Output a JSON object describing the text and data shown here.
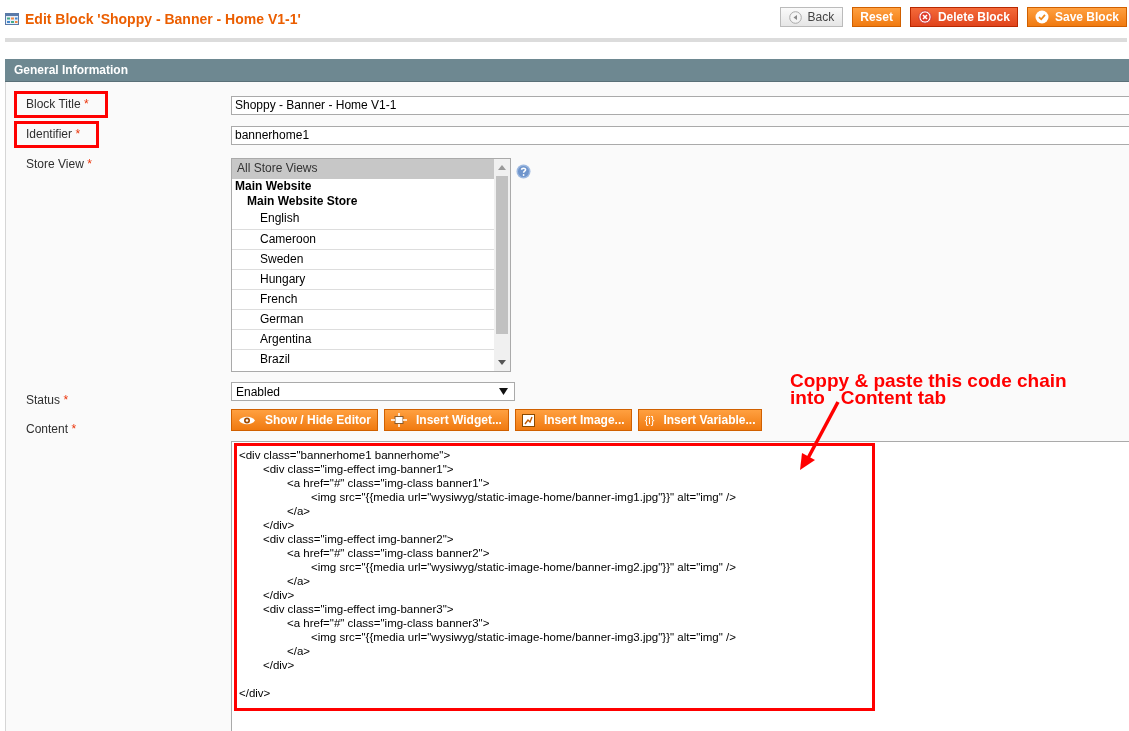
{
  "page": {
    "title": "Edit Block 'Shoppy - Banner - Home V1-1'"
  },
  "actions": [
    {
      "kind": "back",
      "label": "Back"
    },
    {
      "kind": "reset",
      "label": "Reset"
    },
    {
      "kind": "delete",
      "label": "Delete Block"
    },
    {
      "kind": "save",
      "label": "Save Block"
    }
  ],
  "section": {
    "title": "General Information"
  },
  "fields": [
    {
      "kind": "text",
      "label": "Block Title",
      "required_mark": "*",
      "highlighted": true,
      "value": "Shoppy - Banner - Home V1-1"
    },
    {
      "kind": "text",
      "label": "Identifier",
      "required_mark": "*",
      "highlighted": true,
      "value": "bannerhome1"
    },
    {
      "kind": "multiselect",
      "label": "Store View",
      "required_mark": "*",
      "highlighted": false,
      "options": [
        {
          "kind": "option",
          "label": "All Store Views",
          "selected": true
        },
        {
          "kind": "group",
          "label": "Main Website",
          "children": [
            {
              "kind": "group",
              "label": "Main Website Store",
              "children": [
                {
                  "kind": "option",
                  "label": "English",
                  "selected": false
                },
                {
                  "kind": "option",
                  "label": "Cameroon",
                  "selected": false
                },
                {
                  "kind": "option",
                  "label": "Sweden",
                  "selected": false
                },
                {
                  "kind": "option",
                  "label": "Hungary",
                  "selected": false
                },
                {
                  "kind": "option",
                  "label": "French",
                  "selected": false
                },
                {
                  "kind": "option",
                  "label": "German",
                  "selected": false
                },
                {
                  "kind": "option",
                  "label": "Argentina",
                  "selected": false
                },
                {
                  "kind": "option",
                  "label": "Brazil",
                  "selected": false
                }
              ]
            }
          ]
        }
      ]
    },
    {
      "kind": "select",
      "label": "Status",
      "required_mark": "*",
      "highlighted": false,
      "value": "Enabled"
    },
    {
      "kind": "editor",
      "label": "Content",
      "required_mark": "*",
      "highlighted": false,
      "code_highlighted": true,
      "toolbar": [
        {
          "kind": "editor-toggle",
          "label": "Show / Hide Editor"
        },
        {
          "kind": "widget",
          "label": "Insert Widget..."
        },
        {
          "kind": "image",
          "label": "Insert Image..."
        },
        {
          "kind": "variable",
          "label": "Insert Variable...",
          "icon_text": "{i}"
        }
      ],
      "value": "<div class=\"bannerhome1 bannerhome\">\n\t<div class=\"img-effect img-banner1\">\n\t\t<a href=\"#\" class=\"img-class banner1\">\n\t\t\t<img src=\"{{media url=\"wysiwyg/static-image-home/banner-img1.jpg\"}}\" alt=\"img\" />\n\t\t</a>\n\t</div>\n\t<div class=\"img-effect img-banner2\">\n\t\t<a href=\"#\" class=\"img-class banner2\">\n\t\t\t<img src=\"{{media url=\"wysiwyg/static-image-home/banner-img2.jpg\"}}\" alt=\"img\" />\n\t\t</a>\n\t</div>\n\t<div class=\"img-effect img-banner3\">\n\t\t<a href=\"#\" class=\"img-class banner3\">\n\t\t\t<img src=\"{{media url=\"wysiwyg/static-image-home/banner-img3.jpg\"}}\" alt=\"img\" />\n\t\t</a>\n\t</div>\n\n</div>"
    }
  ],
  "annotation": {
    "text": "Coppy & paste this code chain\ninto   Content tab"
  }
}
